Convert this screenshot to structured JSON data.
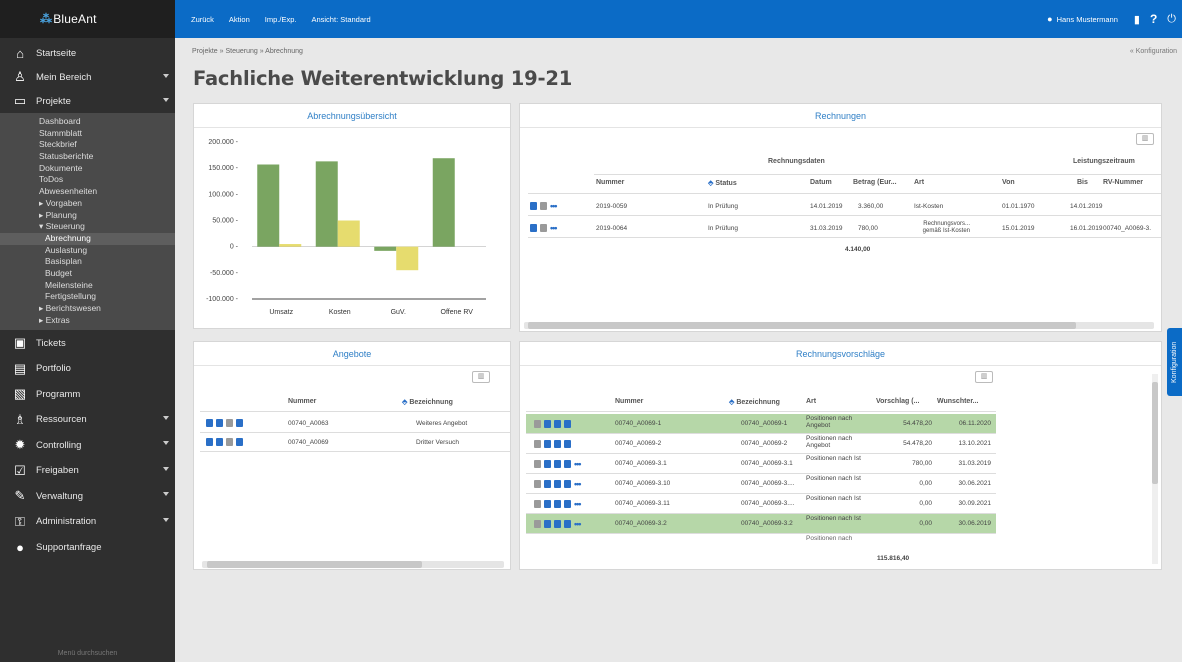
{
  "app": {
    "logo_text": "BlueAnt",
    "menu_search": "Menü durchsuchen"
  },
  "nav": [
    {
      "label": "Startseite",
      "icon": "home-icon",
      "glyph": "⌂",
      "caret": false
    },
    {
      "label": "Mein Bereich",
      "icon": "person-icon",
      "glyph": "♙",
      "caret": true
    },
    {
      "label": "Projekte",
      "icon": "folder-icon",
      "glyph": "▭",
      "caret": true
    }
  ],
  "subnav": [
    "Dashboard",
    "Stammblatt",
    "Steckbrief",
    "Statusberichte",
    "Dokumente",
    "ToDos",
    "Abwesenheiten",
    "▸ Vorgaben",
    "▸ Planung",
    "▾ Steuerung"
  ],
  "subnav2": [
    "Abrechnung",
    "Auslastung",
    "Basisplan",
    "Budget",
    "Meilensteine",
    "Fertigstellung"
  ],
  "subnav3": [
    "▸ Berichtswesen",
    "▸ Extras"
  ],
  "nav2": [
    {
      "label": "Tickets",
      "icon": "tickets-icon",
      "glyph": "▣",
      "caret": false
    },
    {
      "label": "Portfolio",
      "icon": "portfolio-icon",
      "glyph": "▤",
      "caret": false
    },
    {
      "label": "Programm",
      "icon": "programm-icon",
      "glyph": "▧",
      "caret": false
    },
    {
      "label": "Ressourcen",
      "icon": "ressourcen-icon",
      "glyph": "♗",
      "caret": true
    },
    {
      "label": "Controlling",
      "icon": "controlling-icon",
      "glyph": "✹",
      "caret": true
    },
    {
      "label": "Freigaben",
      "icon": "freigaben-icon",
      "glyph": "☑",
      "caret": true
    },
    {
      "label": "Verwaltung",
      "icon": "verwaltung-icon",
      "glyph": "✎",
      "caret": true
    },
    {
      "label": "Administration",
      "icon": "administration-icon",
      "glyph": "⚿",
      "caret": true
    },
    {
      "label": "Supportanfrage",
      "icon": "support-icon",
      "glyph": "●",
      "caret": false
    }
  ],
  "topbar": {
    "items": [
      "Zurück",
      "Aktion",
      "Imp./Exp.",
      "Ansicht: Standard"
    ],
    "user": "Hans Mustermann",
    "help": "?"
  },
  "breadcrumb": "Projekte » Steuerung » Abrechnung",
  "konfig_link": "« Konfiguration",
  "konfig_tab": "Konfiguration",
  "page_title": "Fachliche Weiterentwicklung 19-21",
  "abrechnung": {
    "title": "Abrechnungsübersicht",
    "chart_data": {
      "type": "bar",
      "categories": [
        "Umsatz",
        "Kosten",
        "GuV.",
        "Offene RV"
      ],
      "series": [
        {
          "color": "#7aa561",
          "values": [
            157000,
            163000,
            -8000,
            169000
          ]
        },
        {
          "color": "#e6dc6e",
          "values": [
            5000,
            50000,
            -45000,
            0
          ]
        }
      ],
      "ylim": [
        -100000,
        200000
      ],
      "yticks": [
        "200.000 -",
        "150.000 -",
        "100.000 -",
        "50.000 -",
        "0 -",
        "-50.000 -",
        "-100.000 -"
      ]
    }
  },
  "rechnungen": {
    "title": "Rechnungen",
    "group1": "Rechnungsdaten",
    "group2": "Leistungszeitraum",
    "headers": [
      "Nummer",
      "Status",
      "Datum",
      "Betrag (Eur...",
      "Art",
      "Von",
      "Bis",
      "RV-Nummer"
    ],
    "rows": [
      [
        "2019-0059",
        "In Prüfung",
        "14.01.2019",
        "3.360,00",
        "Ist-Kosten",
        "01.01.1970",
        "14.01.2019",
        ""
      ],
      [
        "2019-0064",
        "In Prüfung",
        "31.03.2019",
        "780,00",
        "Rechnungsvors... gemäß Ist-Kosten",
        "15.01.2019",
        "16.01.2019",
        "00740_A0069-3."
      ]
    ],
    "total": "4.140,00"
  },
  "angebote": {
    "title": "Angebote",
    "headers": [
      "Nummer",
      "Bezeichnung"
    ],
    "rows": [
      [
        "00740_A0063",
        "Weiteres Angebot"
      ],
      [
        "00740_A0069",
        "Dritter Versuch"
      ]
    ]
  },
  "rv": {
    "title": "Rechnungsvorschläge",
    "headers": [
      "Nummer",
      "Bezeichnung",
      "Art",
      "Vorschlag (...",
      "Wunschter..."
    ],
    "rows": [
      [
        "00740_A0069-1",
        "00740_A0069-1",
        "Positionen nach Angebot",
        "54.478,20",
        "06.11.2020"
      ],
      [
        "00740_A0069-2",
        "00740_A0069-2",
        "Positionen nach Angebot",
        "54.478,20",
        "13.10.2021"
      ],
      [
        "00740_A0069-3.1",
        "00740_A0069-3.1",
        "Positionen nach Ist",
        "780,00",
        "31.03.2019"
      ],
      [
        "00740_A0069-3.10",
        "00740_A0069-3....",
        "Positionen nach Ist",
        "0,00",
        "30.06.2021"
      ],
      [
        "00740_A0069-3.11",
        "00740_A0069-3....",
        "Positionen nach Ist",
        "0,00",
        "30.09.2021"
      ],
      [
        "00740_A0069-3.2",
        "00740_A0069-3.2",
        "Positionen nach Ist",
        "0,00",
        "30.06.2019"
      ]
    ],
    "partial_row": "Positionen nach",
    "total": "115.816,40"
  }
}
